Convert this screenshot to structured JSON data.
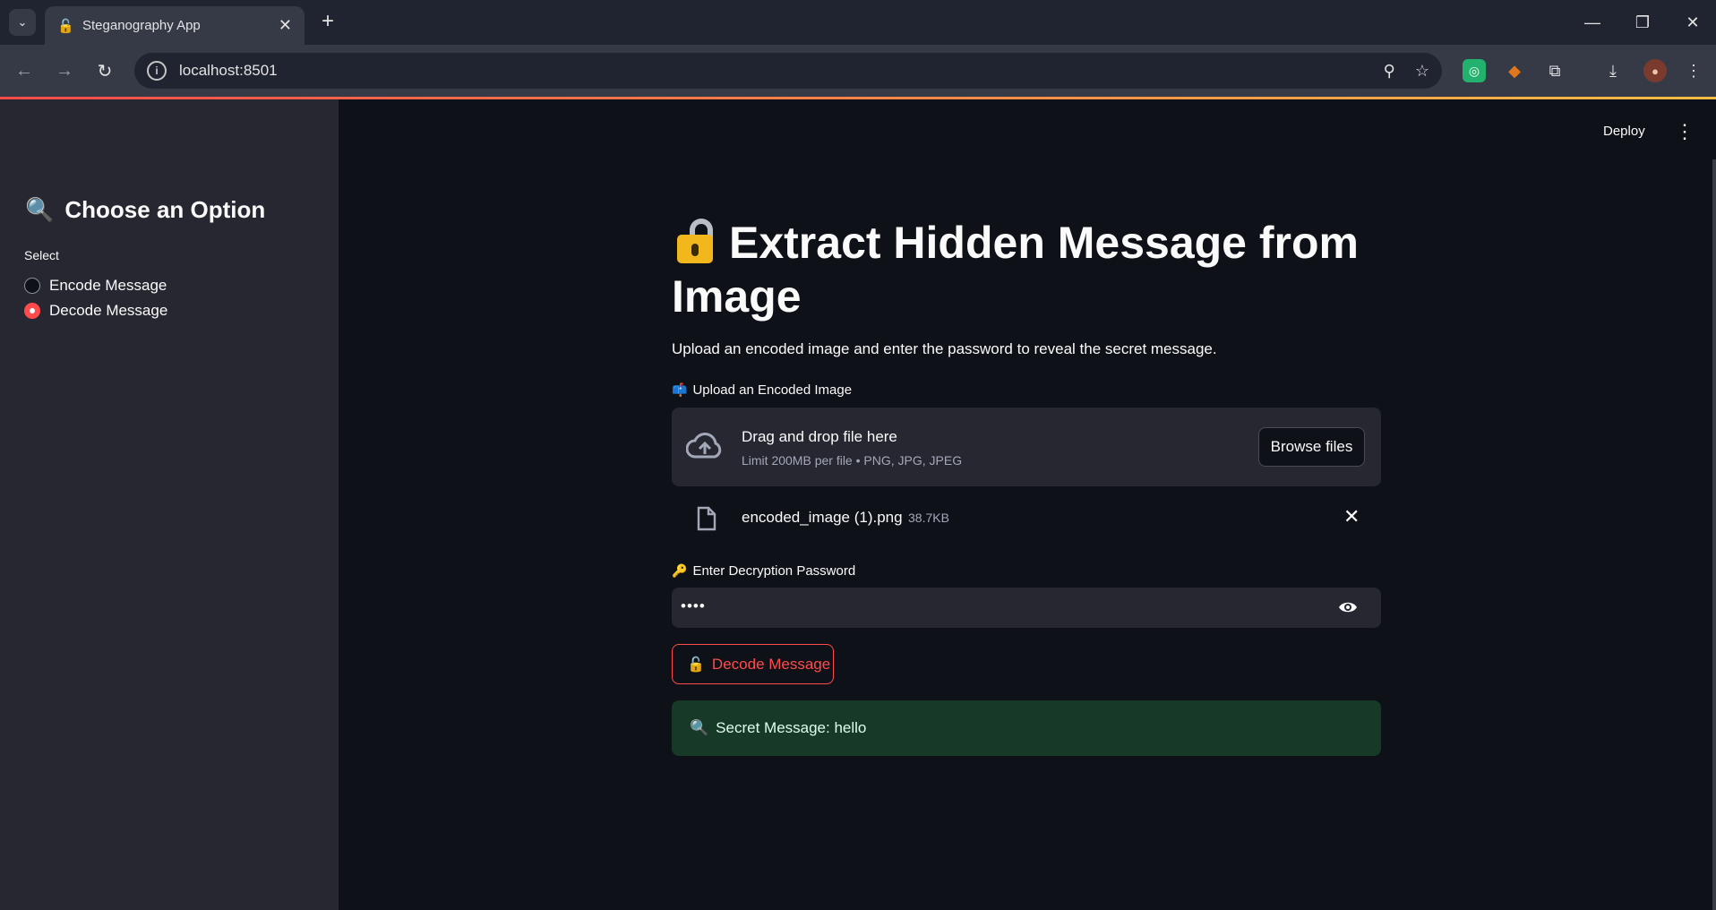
{
  "browser": {
    "tab_title": "Steganography App",
    "url": "localhost:8501",
    "tab_menu_icon": "chevron-down-icon",
    "new_tab_icon": "plus-icon"
  },
  "app_header": {
    "deploy_label": "Deploy"
  },
  "sidebar": {
    "title": "Choose an Option",
    "title_emoji": "magnifier-icon",
    "radio_label": "Select",
    "options": [
      {
        "label": "Encode Message",
        "selected": false
      },
      {
        "label": "Decode Message",
        "selected": true
      }
    ]
  },
  "main": {
    "title": "Extract Hidden Message from Image",
    "subtitle": "Upload an encoded image and enter the password to reveal the secret message.",
    "upload": {
      "label": "Upload an Encoded Image",
      "dropzone_title": "Drag and drop file here",
      "dropzone_subtitle": "Limit 200MB per file • PNG, JPG, JPEG",
      "browse_label": "Browse files"
    },
    "file": {
      "name": "encoded_image (1).png",
      "size": "38.7KB"
    },
    "password": {
      "label": "Enter Decryption Password",
      "value": "••••"
    },
    "decode_button_label": "Decode Message",
    "result": "Secret Message: hello"
  },
  "colors": {
    "primary": "#ff4b4b",
    "background": "#0e1117",
    "sidebar": "#262730",
    "success_bg": "#173928"
  }
}
